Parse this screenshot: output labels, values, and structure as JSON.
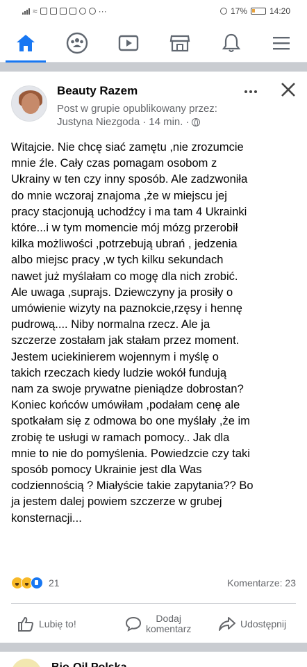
{
  "status_bar": {
    "left_icons": [
      "signal-bars",
      "wifi",
      "sim-icon",
      "mail-icon",
      "mail-icon",
      "image-icon",
      "messenger-icon",
      "vpn-icon",
      "more"
    ],
    "more_indicator": "···",
    "battery": "17%",
    "time": "14:20"
  },
  "nav": {
    "items": [
      "home-icon",
      "groups-icon",
      "watch-icon",
      "marketplace-icon",
      "notifications-icon",
      "menu-icon"
    ],
    "active": "home-icon",
    "accent": "#1877f2"
  },
  "post": {
    "group_name": "Beauty Razem",
    "meta_line1": "Post w grupie opublikowany przez:",
    "author": "Justyna Niezgoda",
    "time": "14 min.",
    "separator": "·",
    "text": "Witajcie. Nie chcę siać zamętu ,nie zrozumcie\nmnie źle. Cały czas pomagam osobom z\nUkrainy w ten czy inny sposób. Ale zadzwoniła\ndo mnie wczoraj znajoma ,że w miejscu jej\npracy stacjonują uchodźcy i ma tam 4 Ukrainki\nktóre...i w tym momencie mój mózg przerobił\nkilka możliwości ,potrzebują ubrań , jedzenia\nalbo miejsc pracy ,w tych kilku sekundach\nnawet już myślałam co mogę dla nich zrobić.\nAle uwaga ,suprajs. Dziewczyny ja prosiły o\numówienie wizyty na paznokcie,rzęsy i hennę\npudrową.... Niby normalna rzecz. Ale ja\nszczerze zostałam jak stałam przez moment.\nJestem uciekinierem wojennym i myślę o\ntakich rzeczach kiedy ludzie wokół fundują\nnam za swoje prywatne pieniądze dobrostan?\nKoniec końców umówiłam ,podałam cenę ale\nspotkałam się z odmowa bo one myślały ,że im\nzrobię te usługi w ramach pomocy.. Jak dla\nmnie to nie do pomyślenia. Powiedzcie czy taki\nsposób pomocy Ukrainie jest dla Was\ncodziennością ? Miałyście takie zapytania?? Bo\nja jestem dalej powiem szczerze w grubej\nkonsternacji...",
    "reactions": [
      "haha",
      "wow",
      "like"
    ],
    "reaction_count": "21",
    "comments_count": "Komentarze: 23",
    "actions": {
      "like": "Lubię to!",
      "comment": "Dodaj\nkomentarz",
      "share": "Udostępnij"
    }
  },
  "next_post": {
    "name_partial": "Bio-Oil Polska"
  }
}
